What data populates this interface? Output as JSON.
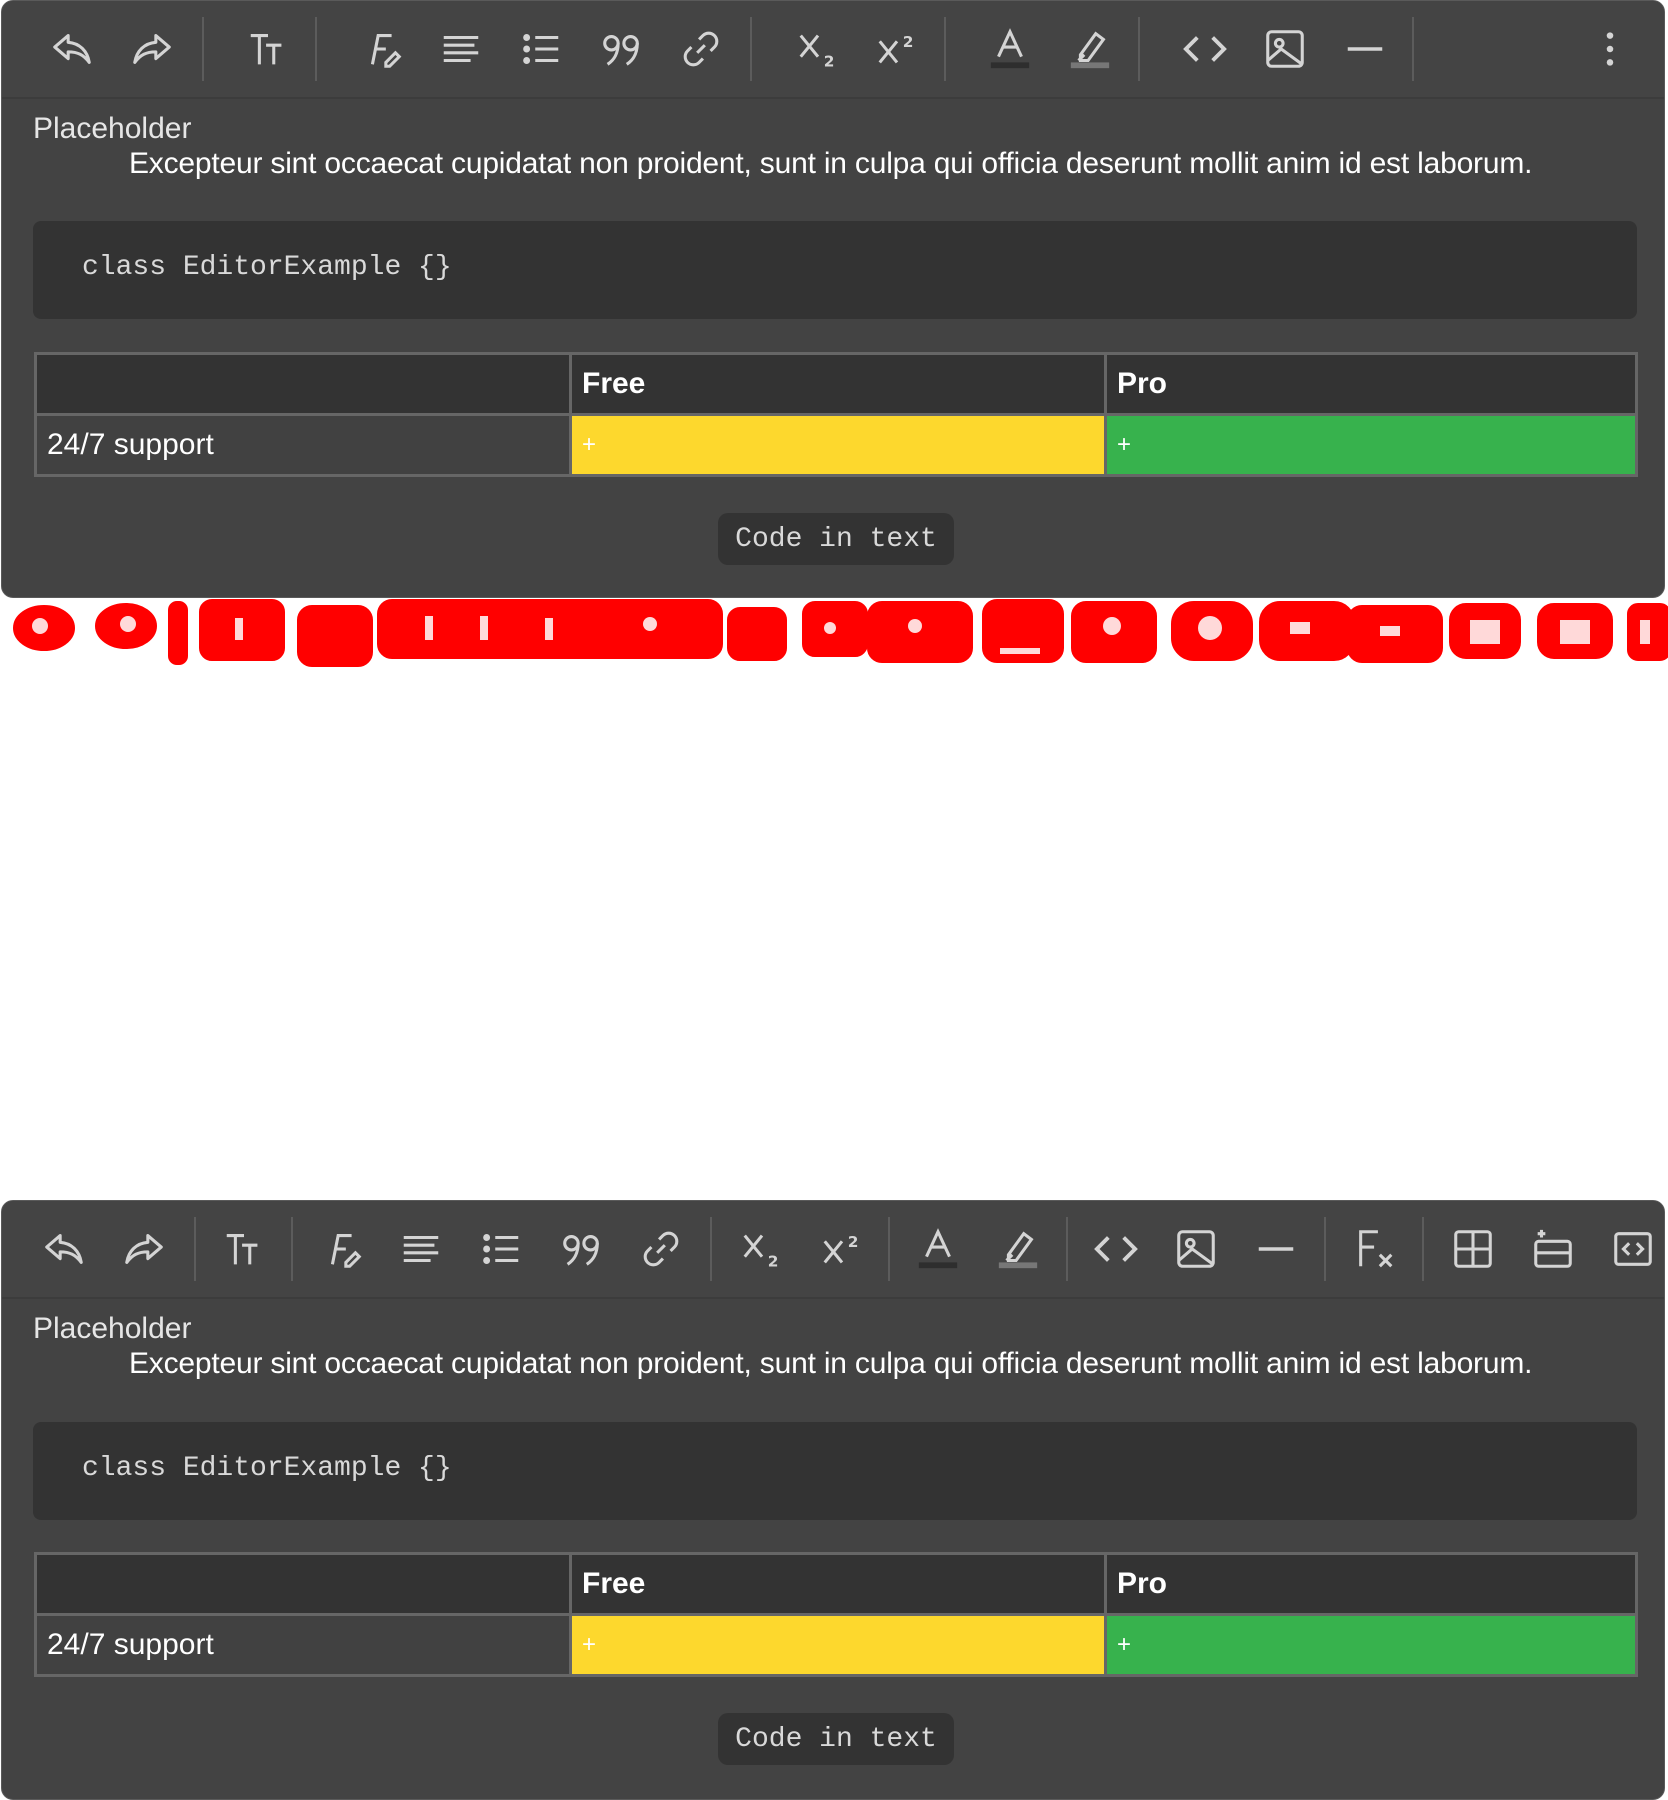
{
  "editors": [
    {
      "toolbar": [
        "undo",
        "redo",
        "text-size",
        "font",
        "align",
        "list",
        "quote",
        "link",
        "subscript",
        "superscript",
        "text-color",
        "highlight",
        "code",
        "image",
        "horizontal-rule",
        "more"
      ],
      "placeholder": "Placeholder",
      "paragraph": "Excepteur sint occaecat cupidatat non proident, sunt in culpa qui officia deserunt mollit anim id est laborum.",
      "code_block": "class EditorExample {}",
      "table": {
        "headers": [
          "",
          "Free",
          "Pro"
        ],
        "rows": [
          [
            "24/7 support",
            "+",
            "+"
          ]
        ]
      },
      "inline_code": "Code in text"
    },
    {
      "toolbar": [
        "undo",
        "redo",
        "text-size",
        "font",
        "align",
        "list",
        "quote",
        "link",
        "subscript",
        "superscript",
        "text-color",
        "highlight",
        "code",
        "image",
        "horizontal-rule",
        "clear-format",
        "table",
        "insert-row",
        "embed"
      ],
      "placeholder": "Placeholder",
      "paragraph": "Excepteur sint occaecat cupidatat non proident, sunt in culpa qui officia deserunt mollit anim id est laborum.",
      "code_block": "class EditorExample {}",
      "table": {
        "headers": [
          "",
          "Free",
          "Pro"
        ],
        "rows": [
          [
            "24/7 support",
            "+",
            "+"
          ]
        ]
      },
      "inline_code": "Code in text"
    }
  ],
  "colors": {
    "editor_bg": "#434343",
    "code_bg": "#333333",
    "free_cell": "#fdd82d",
    "pro_cell": "#37b24d",
    "ghost_overlay": "#ff0000"
  }
}
